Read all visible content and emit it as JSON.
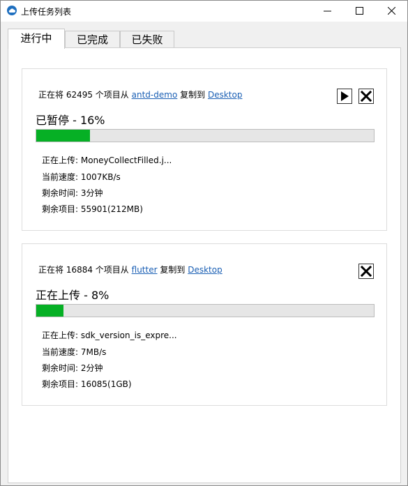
{
  "window": {
    "title": "上传任务列表"
  },
  "tabs": [
    "进行中",
    "已完成",
    "已失败"
  ],
  "tasks": [
    {
      "desc_prefix": "正在将 62495 个项目从",
      "source": "antd-demo",
      "desc_mid": "复制到",
      "target": "Desktop",
      "status": "已暂停 - 16%",
      "progress": 0.16,
      "uploading": "正在上传: MoneyCollectFilled.j...",
      "speed": "当前速度: 1007KB/s",
      "time_left": "剩余时间: 3分钟",
      "items_left": "剩余项目: 55901(212MB)"
    },
    {
      "desc_prefix": "正在将 16884 个项目从",
      "source": "flutter",
      "desc_mid": "复制到",
      "target": "Desktop",
      "status": "正在上传 - 8%",
      "progress": 0.08,
      "uploading": "正在上传: sdk_version_is_expre...",
      "speed": "当前速度: 7MB/s",
      "time_left": "剩余时间: 2分钟",
      "items_left": "剩余项目: 16085(1GB)"
    }
  ],
  "icons": {
    "app": "cloud-icon",
    "resume": "play-icon",
    "cancel": "close-icon"
  },
  "colors": {
    "progress": "#06b025",
    "link": "#1a5fb4"
  }
}
